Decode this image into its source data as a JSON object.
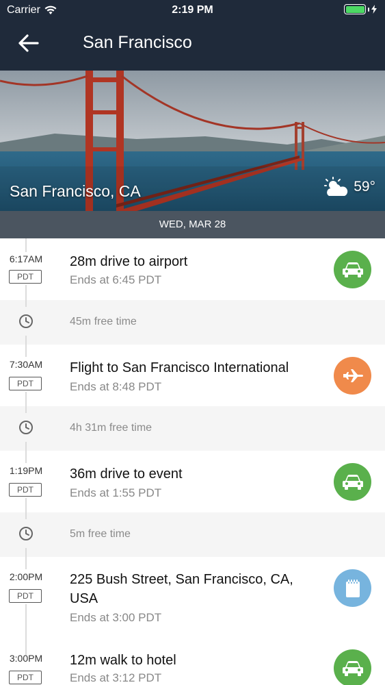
{
  "status_bar": {
    "carrier": "Carrier",
    "time": "2:19 PM",
    "battery_level": 1.0,
    "battery_color": "#4cd964"
  },
  "nav": {
    "back_icon": "arrow-left-icon",
    "title": "San Francisco"
  },
  "hero": {
    "city": "San Francisco, CA",
    "weather_icon": "partly-cloudy-icon",
    "temperature": "59°"
  },
  "date_header": "WED, MAR 28",
  "colors": {
    "nav_bg": "#1f2a3a",
    "green": "#5ab04c",
    "orange": "#f08a4b",
    "blue": "#77b4de"
  },
  "events": [
    {
      "time": "6:17AM",
      "tz": "PDT",
      "title": "28m drive to airport",
      "subtitle": "Ends at 6:45 PDT",
      "icon": "car-icon"
    },
    {
      "time": "7:30AM",
      "tz": "PDT",
      "title": "Flight to San Francisco International",
      "subtitle": "Ends at 8:48 PDT",
      "icon": "airplane-icon"
    },
    {
      "time": "1:19PM",
      "tz": "PDT",
      "title": "36m drive to event",
      "subtitle": "Ends at 1:55 PDT",
      "icon": "car-icon"
    },
    {
      "time": "2:00PM",
      "tz": "PDT",
      "title": "225 Bush Street, San Francisco, CA, USA",
      "subtitle": "Ends at 3:00 PDT",
      "icon": "notepad-icon"
    },
    {
      "time": "3:00PM",
      "tz": "PDT",
      "title": "12m walk to hotel",
      "subtitle": "Ends at 3:12 PDT",
      "icon": "car-icon"
    }
  ],
  "free_times": [
    {
      "text": "45m free time",
      "icon": "clock-icon"
    },
    {
      "text": "4h 31m free time",
      "icon": "clock-icon"
    },
    {
      "text": "5m free time",
      "icon": "clock-icon"
    }
  ]
}
